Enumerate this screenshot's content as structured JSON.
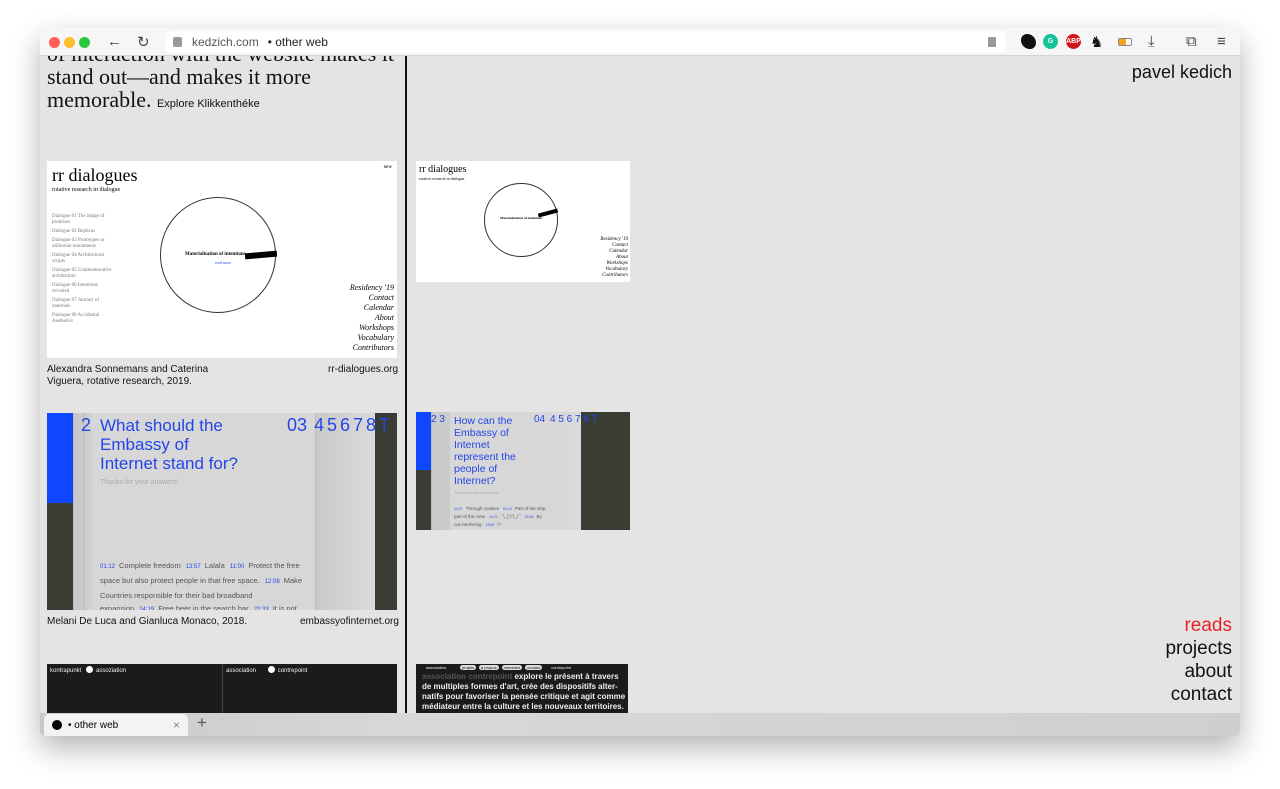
{
  "browser": {
    "url_domain": "kedzich.com",
    "url_title": "• other web",
    "tab_label": "• other web",
    "new_tab": "+",
    "tab_close": "×"
  },
  "intro": {
    "text": "of interaction with the website makes it stand out—and makes it more memorable.",
    "link": "Explore Klikkenthéke"
  },
  "site_title": "pavel kedich",
  "nav": [
    {
      "label": "reads",
      "active": true
    },
    {
      "label": "projects"
    },
    {
      "label": "about"
    },
    {
      "label": "contact"
    }
  ],
  "colors": {
    "active": "#e8232b",
    "blue": "#2446e8",
    "dark": "#3a3d33"
  },
  "projects": [
    {
      "title": "rr dialogues",
      "subtitle": "rotative research in dialogue",
      "center": "Materialisation of intentions",
      "readmore": "read more",
      "corner": "new",
      "dialogues": [
        "Dialogue 01 The image of promises",
        "Dialogue 02 Replicas",
        "Dialogue 03 Prototypes or utilitarian monuments",
        "Dialogue 04 Architectural scripts",
        "Dialogue 05 Commemorative architecture",
        "Dialogue 06 Intentions revisited",
        "Dialogue 07 Journey of materials",
        "Dialogue 08 Accidental Aesthetics"
      ],
      "menu": [
        "Residency '19",
        "Contact",
        "Calendar",
        "About",
        "Workshops",
        "Vocabulary",
        "Contributors"
      ],
      "caption": "Alexandra Sonnemans and Caterina Viguera, rotative research, 2019.",
      "link": "rr-dialogues.org"
    },
    {
      "question": "What should the Embassy of Internet stand for?",
      "question2": "How can the Embassy of Internet represent the people of Internet?",
      "num": "03",
      "num2": "04",
      "nums": "4 5 6 7 8 T",
      "left_nums": "2",
      "left_nums2": "2 3",
      "thanks": "Thanks for your answers!",
      "answers": [
        [
          "01:12",
          "Complete freedom"
        ],
        [
          "13:57",
          "Lalala"
        ],
        [
          "11:00",
          "Protect the free space but also protect people in that free space."
        ],
        [
          "12:08",
          "Make Countries responsible for their bad broadband expansion"
        ],
        [
          "14:19",
          "Free beer in the search bar"
        ],
        [
          "22:33",
          "It is not needed"
        ]
      ],
      "answers2": [
        [
          "14:27",
          "Through cookies"
        ],
        [
          "01:12",
          "Part of the ship, part of the crew"
        ],
        [
          "14:21",
          "¯\\_(ツ)_/¯"
        ],
        [
          "20:34",
          "By not interfering"
        ],
        [
          "12:50",
          "!?"
        ]
      ],
      "caption": "Melani De Luca and Gianluca Monaco, 2018.",
      "link": "embassyofinternet.org"
    },
    {
      "left_header": [
        "kontrapunkt",
        "assoziation"
      ],
      "right_header": [
        "association",
        "contrepoint"
      ],
      "small_header": "association",
      "tags": [
        "projets",
        "à propos",
        "membres",
        "contact"
      ],
      "small_header2": "contrepoint",
      "highlight": "association contrepoint",
      "text": "explore le présent à travers de multiples formes d'art, crée des dispositifs alter-natifs pour favoriser la pensée critique et agit comme médiateur entre la culture et les nouveaux territoires."
    }
  ]
}
